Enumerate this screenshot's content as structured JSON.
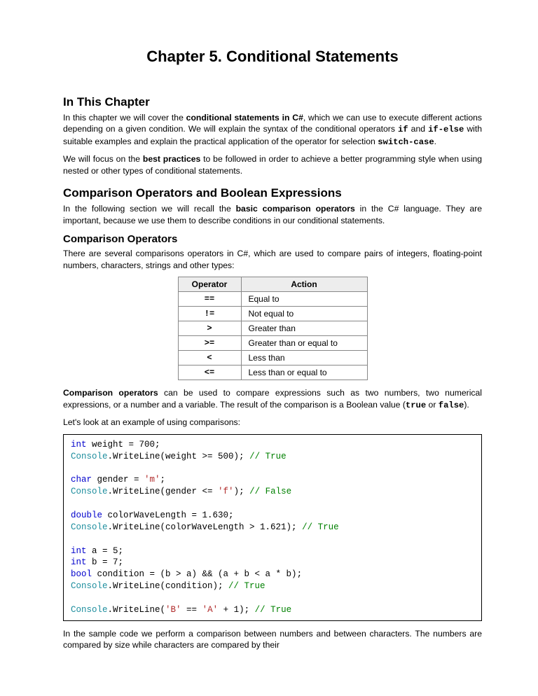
{
  "title": "Chapter 5. Conditional Statements",
  "section1": {
    "heading": "In This Chapter",
    "p1_a": "In this chapter we will cover the ",
    "p1_b": "conditional statements in C#",
    "p1_c": ", which we can use to execute different actions depending on a given condition. We will explain the syntax of the conditional operators ",
    "p1_d": "if",
    "p1_e": " and ",
    "p1_f": "if-else",
    "p1_g": " with suitable examples and explain the practical application of the operator for selection ",
    "p1_h": "switch-case",
    "p1_i": ".",
    "p2_a": "We will focus on the ",
    "p2_b": "best practices",
    "p2_c": " to be followed in order to achieve a better programming style when using nested or other types of conditional statements."
  },
  "section2": {
    "heading": "Comparison Operators and Boolean Expressions",
    "p1_a": "In the following section we will recall the ",
    "p1_b": "basic comparison operators",
    "p1_c": " in the C# language. They are important, because we use them to describe conditions in our conditional statements."
  },
  "section3": {
    "heading": "Comparison Operators",
    "p1": "There are several comparisons operators in C#, which are used to compare pairs of integers, floating-point numbers, characters, strings and other types:",
    "table": {
      "h1": "Operator",
      "h2": "Action",
      "rows": [
        {
          "op": "==",
          "act": "Equal to"
        },
        {
          "op": "!=",
          "act": "Not equal to"
        },
        {
          "op": ">",
          "act": "Greater than"
        },
        {
          "op": ">=",
          "act": "Greater than or equal to"
        },
        {
          "op": "<",
          "act": "Less than"
        },
        {
          "op": "<=",
          "act": "Less than or equal to"
        }
      ]
    },
    "p2_a": "Comparison operators",
    "p2_b": " can be used to compare expressions such as two numbers, two numerical expressions, or a number and a variable. The result of the comparison is a Boolean value (",
    "p2_c": "true",
    "p2_d": " or ",
    "p2_e": "false",
    "p2_f": ").",
    "p3": "Let's look at an example of using comparisons:"
  },
  "code": {
    "l01a": "int",
    "l01b": " weight = 700;",
    "l02a": "Console",
    "l02b": ".WriteLine(weight >= 500); ",
    "l02c": "// True",
    "l04a": "char",
    "l04b": " gender = ",
    "l04c": "'m'",
    "l04d": ";",
    "l05a": "Console",
    "l05b": ".WriteLine(gender <= ",
    "l05c": "'f'",
    "l05d": "); ",
    "l05e": "// False",
    "l07a": "double",
    "l07b": " colorWaveLength = 1.630;",
    "l08a": "Console",
    "l08b": ".WriteLine(colorWaveLength > 1.621); ",
    "l08c": "// True",
    "l10a": "int",
    "l10b": " a = 5;",
    "l11a": "int",
    "l11b": " b = 7;",
    "l12a": "bool",
    "l12b": " condition = (b > a) && (a + b < a * b);",
    "l13a": "Console",
    "l13b": ".WriteLine(condition); ",
    "l13c": "// True",
    "l15a": "Console",
    "l15b": ".WriteLine(",
    "l15c": "'B'",
    "l15d": " == ",
    "l15e": "'A'",
    "l15f": " + 1); ",
    "l15g": "// True"
  },
  "after": "In the sample code we perform a comparison between numbers and between characters. The numbers are compared by size while characters are compared by their"
}
